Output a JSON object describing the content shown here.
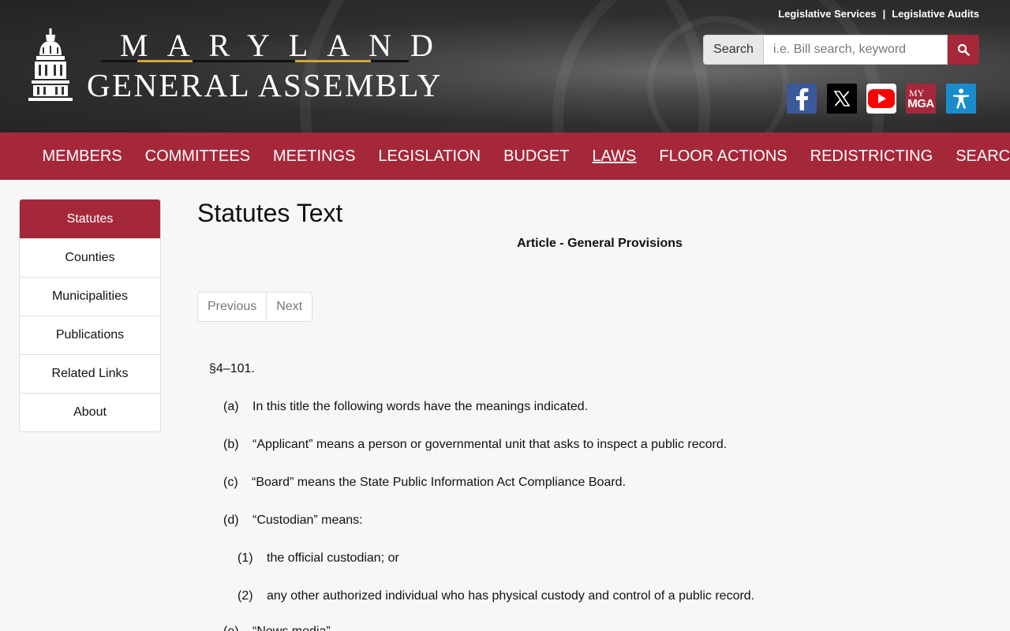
{
  "header": {
    "top_links": [
      "Legislative Services",
      "Legislative Audits"
    ],
    "top_link_separator": "|",
    "logo_title": "MARYLAND",
    "logo_subtitle": "GENERAL ASSEMBLY",
    "search": {
      "label": "Search",
      "placeholder": "i.e. Bill search, keyword",
      "button_icon": "search-icon"
    },
    "social": [
      {
        "name": "facebook-icon",
        "color": "#3b5998"
      },
      {
        "name": "x-icon",
        "color": "#000000"
      },
      {
        "name": "youtube-icon",
        "color": "#ff0000"
      },
      {
        "name": "mymga-icon",
        "color": "#a5283a",
        "text_top": "MY",
        "text_bottom": "MGA"
      },
      {
        "name": "accessibility-icon",
        "color": "#1a8ccc"
      }
    ]
  },
  "nav": {
    "items": [
      "MEMBERS",
      "COMMITTEES",
      "MEETINGS",
      "LEGISLATION",
      "BUDGET",
      "LAWS",
      "FLOOR ACTIONS",
      "REDISTRICTING",
      "SEARCH"
    ],
    "active": "LAWS"
  },
  "sidebar": {
    "items": [
      "Statutes",
      "Counties",
      "Municipalities",
      "Publications",
      "Related Links",
      "About"
    ],
    "active": "Statutes"
  },
  "main": {
    "title": "Statutes Text",
    "article": "Article - General Provisions",
    "pager": {
      "previous": "Previous",
      "next": "Next"
    },
    "section": "§4–101.",
    "paragraphs": [
      {
        "label": "(a)",
        "text": "In this title the following words have the meanings indicated."
      },
      {
        "label": "(b)",
        "text": "“Applicant” means a person or governmental unit that asks to inspect a public record."
      },
      {
        "label": "(c)",
        "text": "“Board” means the State Public Information Act Compliance Board."
      },
      {
        "label": "(d)",
        "text": "“Custodian” means:"
      },
      {
        "label": "(1)",
        "text": "the official custodian; or"
      },
      {
        "label": "(2)",
        "text": "any other authorized individual who has physical custody and control of a public record."
      },
      {
        "label": "(e)",
        "text": "“News media”"
      }
    ]
  },
  "colors": {
    "brand": "#a5283a",
    "gold": "#d4a634"
  }
}
